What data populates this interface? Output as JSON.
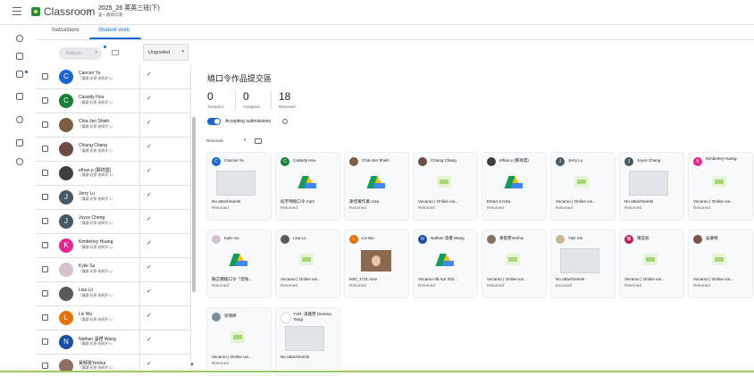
{
  "app": {
    "title": "Classroom",
    "course_name": "2025_26 英英三班(下)",
    "course_subtitle": "會一教師印識"
  },
  "tabs": [
    {
      "label": "Instructions"
    },
    {
      "label": "Student work"
    }
  ],
  "toolbar": {
    "return_label": "Return",
    "filter_value": "Ungraded"
  },
  "students": [
    {
      "name": "Cancan Yu",
      "status": "『講讀·初探·老師評·1』",
      "initial": "C",
      "color": "#1967d2"
    },
    {
      "name": "Cassidy Hou",
      "status": "『講讀·初探·老師評·1』",
      "initial": "C",
      "color": "#188038"
    },
    {
      "name": "Chia-Jen Shieh",
      "status": "『講讀·初探·老師評·1』",
      "initial": "",
      "color": "#7b5e3f"
    },
    {
      "name": "Chiung Chang",
      "status": "『講讀·初探·老師評·1』",
      "initial": "",
      "color": "#6d4c41"
    },
    {
      "name": "ethan p (鄭祥盟)",
      "status": "『講讀·初探·老師評·1』",
      "initial": "",
      "color": "#3c4043"
    },
    {
      "name": "Jerry Lu",
      "status": "『講讀·初探·老師評·1』",
      "initial": "J",
      "color": "#455a64"
    },
    {
      "name": "Joyce Cheng",
      "status": "『講讀·初探·老師評·1』",
      "initial": "J",
      "color": "#455a64"
    },
    {
      "name": "Kimberley Huang",
      "status": "『講讀·初探·老師評·1』",
      "initial": "K",
      "color": "#e52592"
    },
    {
      "name": "Kylie Su",
      "status": "『講讀·初探·老師評·1』",
      "initial": "",
      "color": "#d7c1cf"
    },
    {
      "name": "Lisa Lo",
      "status": "『講讀·初探·老師評·1』",
      "initial": "",
      "color": "#5a5a5a"
    },
    {
      "name": "Liv Wu",
      "status": "『講讀·初探·老師評·1』",
      "initial": "L",
      "color": "#e8710a"
    },
    {
      "name": "Nathan 溫禮 Wang",
      "status": "『講讀·初探·老師評·1』",
      "initial": "N",
      "color": "#174ea6"
    },
    {
      "name": "黃郁雯Yenhui",
      "status": "『講讀·初探·老師評·1』",
      "initial": "",
      "color": "#8d6e63"
    }
  ],
  "panel": {
    "title": "繞口令作品提交區",
    "stats": [
      {
        "value": "0",
        "label": "Turned in"
      },
      {
        "value": "0",
        "label": "Assigned"
      },
      {
        "value": "18",
        "label": "Returned"
      }
    ],
    "accepting_label": "Accepting submissions",
    "filter_label": "Returned"
  },
  "cards": [
    {
      "name": "Cancan Yu",
      "file": "No attachments",
      "status": "Returned",
      "thumb": "blank",
      "initial": "C",
      "color": "#1967d2"
    },
    {
      "name": "Cassidy Hou",
      "file": "侯宇晴繞口令.mp3",
      "status": "Returned",
      "thumb": "drive",
      "initial": "C",
      "color": "#188038"
    },
    {
      "name": "Chia-Jen Shieh",
      "file": "謝佳蓁作業.m4a",
      "status": "Returned",
      "thumb": "drive",
      "initial": "",
      "color": "#7b5e3f"
    },
    {
      "name": "Chiung Chang",
      "file": "Vocaroo | Online voi...",
      "status": "Returned",
      "thumb": "voc",
      "initial": "",
      "color": "#6d4c41"
    },
    {
      "name": "ethan p (鄭祥盟)",
      "file": "Ethan 2.m4a",
      "status": "Returned",
      "thumb": "drive",
      "initial": "",
      "color": "#3c4043"
    },
    {
      "name": "Jerry Lu",
      "file": "Vocaroo | Online voi...",
      "status": "Returned",
      "thumb": "voc",
      "initial": "J",
      "color": "#455a64"
    },
    {
      "name": "Joyce Cheng",
      "file": "No attachments",
      "status": "Returned",
      "thumb": "blank",
      "initial": "J",
      "color": "#455a64"
    },
    {
      "name": "Kimberley Huang",
      "file": "Vocaroo | Online voi...",
      "status": "Returned",
      "thumb": "voc",
      "initial": "K",
      "color": "#e52592"
    },
    {
      "name": "Kylie Su",
      "file": "蘇芷嫻繞口令「望兔...",
      "status": "Returned",
      "thumb": "drive",
      "initial": "",
      "color": "#d7c1cf"
    },
    {
      "name": "Lisa Lo",
      "file": "Vocaroo | Online voi...",
      "status": "Returned",
      "thumb": "voc",
      "initial": "",
      "color": "#5a5a5a"
    },
    {
      "name": "Liv Wu",
      "file": "IMG_1711.mov",
      "status": "Returned",
      "thumb": "img",
      "initial": "L",
      "color": "#e8710a"
    },
    {
      "name": "Nathan 溫禮 Wang",
      "file": "Vocaroo 08 Apr 202...",
      "status": "Returned",
      "thumb": "drive",
      "initial": "N",
      "color": "#174ea6"
    },
    {
      "name": "黃郁雯Yenhui",
      "file": "Vocaroo | Online voi...",
      "status": "Returned",
      "thumb": "voc",
      "initial": "",
      "color": "#8d6e63"
    },
    {
      "name": "Yuki Sio",
      "file": "No attachments",
      "status": "Excused",
      "thumb": "blank",
      "initial": "",
      "color": "#c9b79c"
    },
    {
      "name": "陳宜如",
      "file": "Vocaroo | Online voi...",
      "status": "Returned",
      "thumb": "voc",
      "initial": "陳",
      "color": "#c2185b"
    },
    {
      "name": "吳睿桐",
      "file": "Vocaroo | Online voi...",
      "status": "Returned",
      "thumb": "voc",
      "initial": "",
      "color": "#795548"
    },
    {
      "name": "梁瑀婷",
      "file": "Vocaroo | Online voi...",
      "status": "Returned",
      "thumb": "voc",
      "initial": "",
      "color": "#78909c"
    },
    {
      "name": "YVR- 湯雅雯 (Serena Tang)",
      "file": "No attachments",
      "status": "",
      "thumb": "blank",
      "initial": "",
      "color": "#ffffff"
    }
  ]
}
